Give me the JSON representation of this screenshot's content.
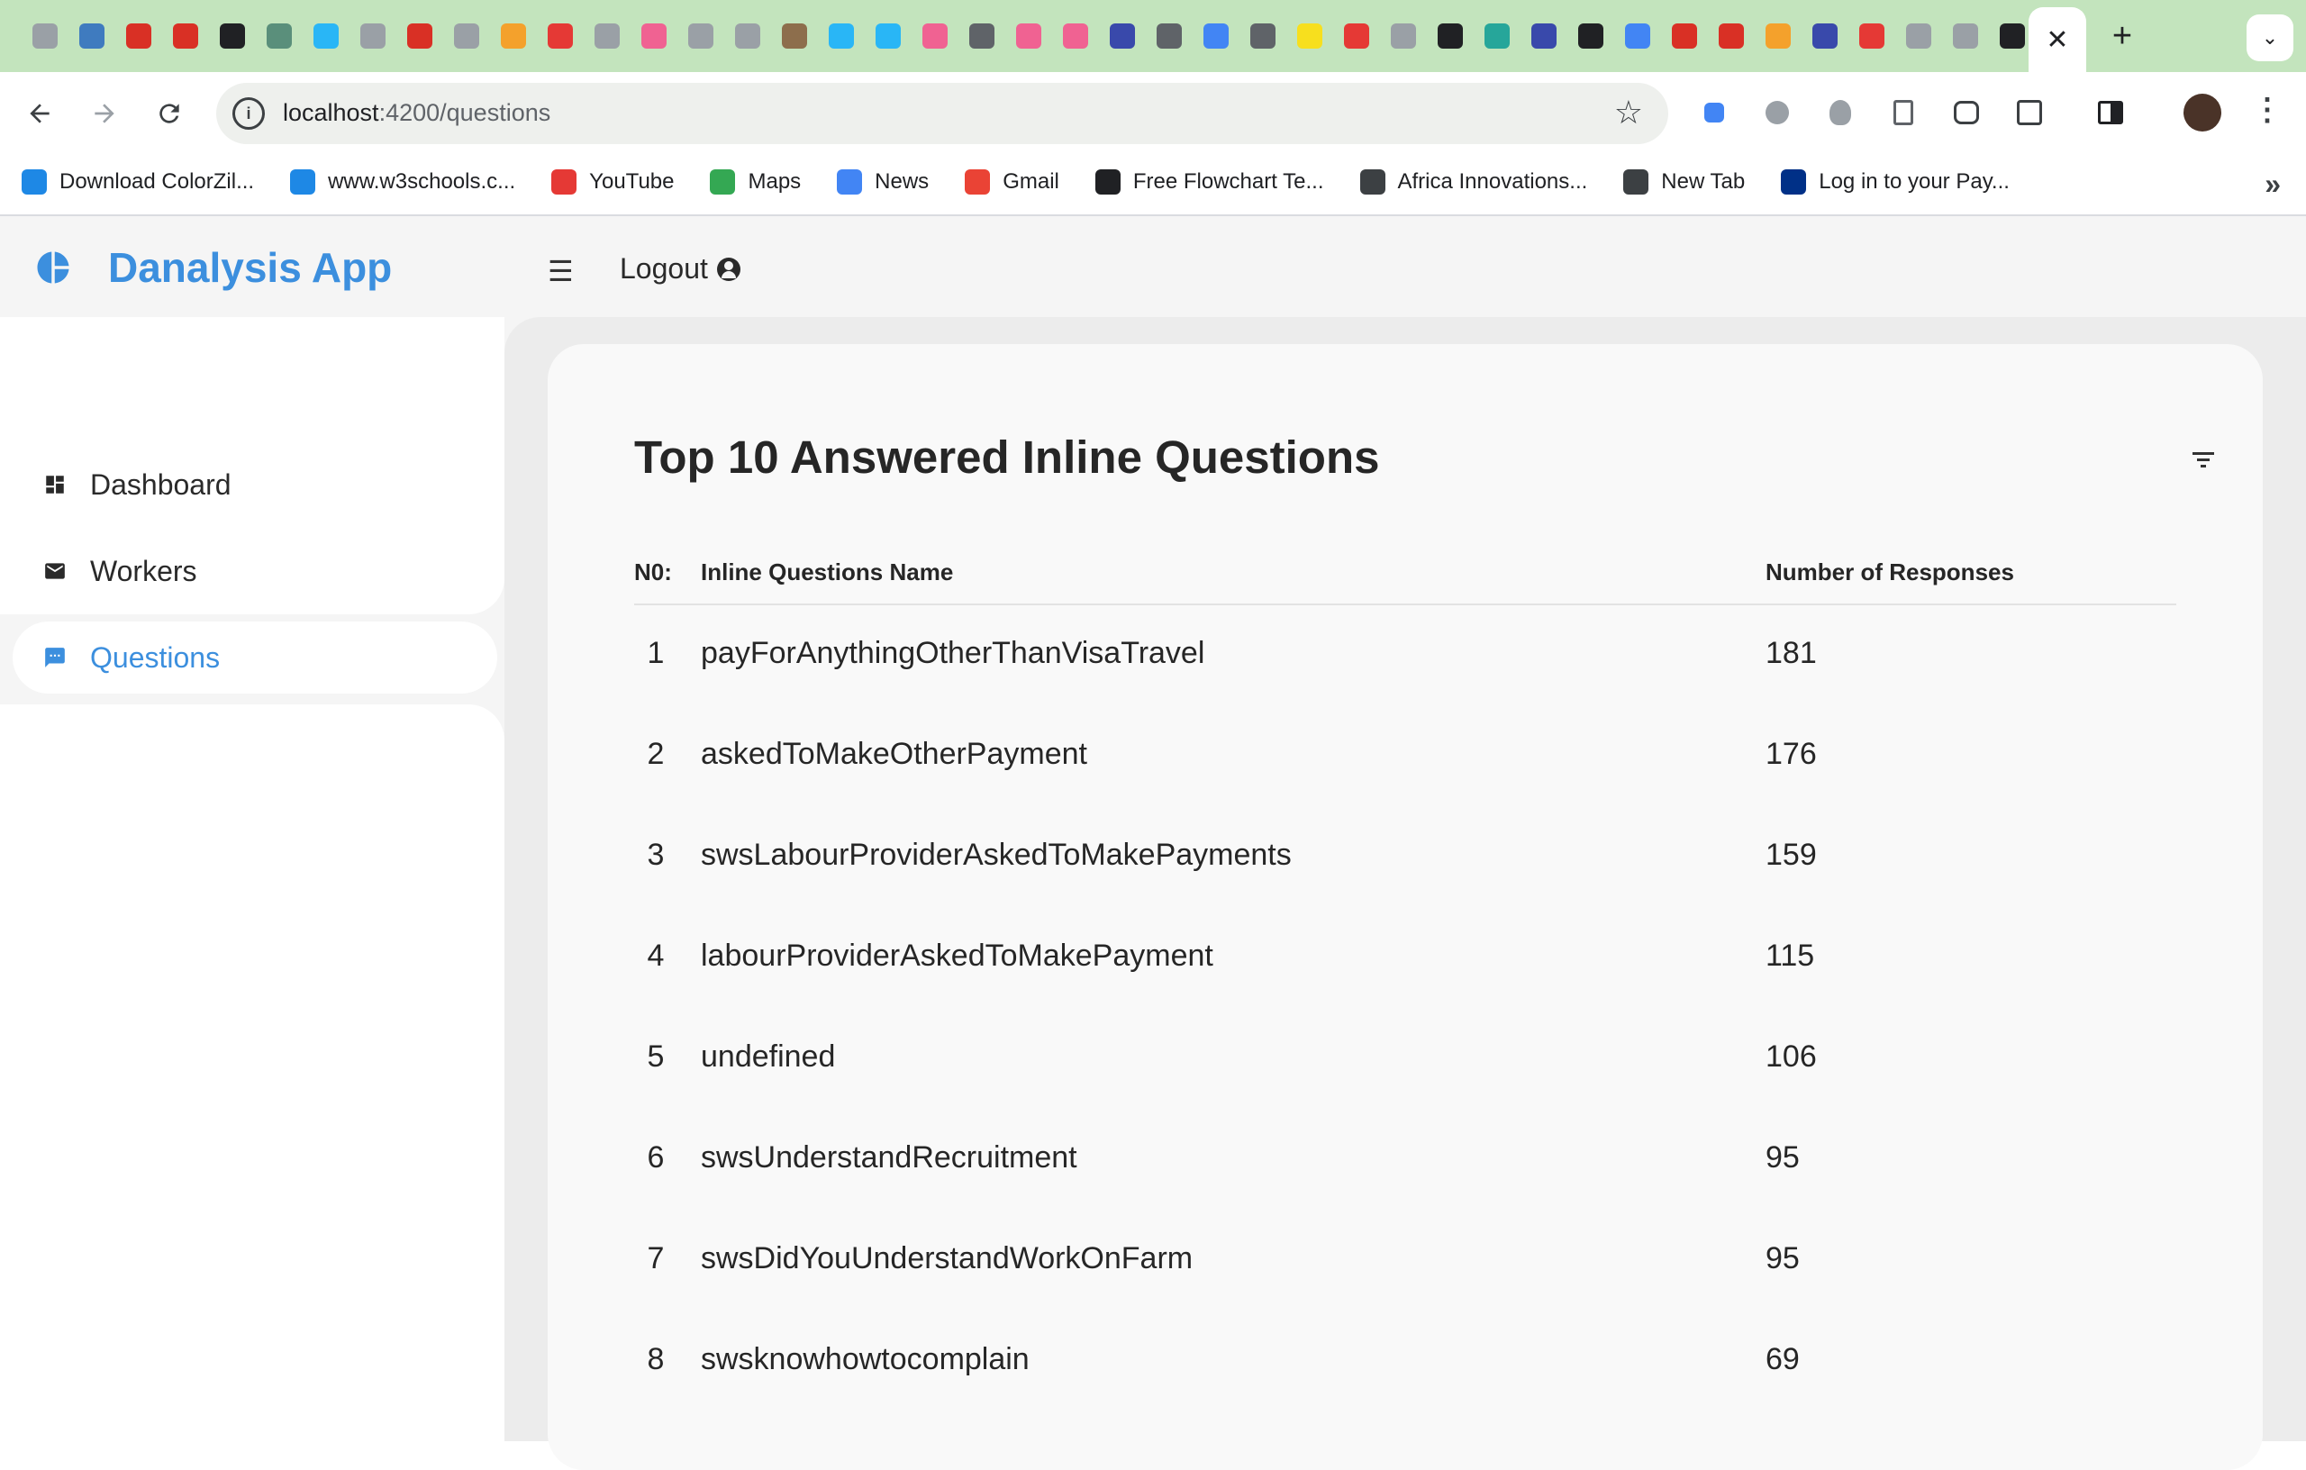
{
  "browser": {
    "active_tab_close": "✕",
    "new_tab": "+",
    "tab_menu": "⌄",
    "url_host": "localhost",
    "url_path": ":4200/questions",
    "tab_icon_colors": [
      "#9aa0a6",
      "#3f7bbf",
      "#d93025",
      "#d93025",
      "#202124",
      "#5a8f7b",
      "#29b6f6",
      "#9aa0a6",
      "#d93025",
      "#9aa0a6",
      "#f4a12c",
      "#e53935",
      "#9aa0a6",
      "#f06292",
      "#9aa0a6",
      "#9aa0a6",
      "#8d6e4c",
      "#29b6f6",
      "#29b6f6",
      "#f06292",
      "#5f6368",
      "#f06292",
      "#f06292",
      "#3949ab",
      "#5f6368",
      "#4285f4",
      "#5f6368",
      "#f7df1e",
      "#e53935",
      "#9aa0a6",
      "#202124",
      "#26a69a",
      "#3949ab",
      "#202124",
      "#4285f4",
      "#d93025",
      "#d93025",
      "#f4a12c",
      "#3949ab",
      "#e53935",
      "#9aa0a6",
      "#9aa0a6",
      "#202124",
      "#8d6e4c"
    ]
  },
  "bookmarks": [
    {
      "label": "Download ColorZil...",
      "color": "#1e88e5"
    },
    {
      "label": "www.w3schools.c...",
      "color": "#1e88e5"
    },
    {
      "label": "YouTube",
      "color": "#e53935"
    },
    {
      "label": "Maps",
      "color": "#34a853"
    },
    {
      "label": "News",
      "color": "#4285f4"
    },
    {
      "label": "Gmail",
      "color": "#ea4335"
    },
    {
      "label": "Free Flowchart Te...",
      "color": "#202124"
    },
    {
      "label": "Africa Innovations...",
      "color": "#3c4043"
    },
    {
      "label": "New Tab",
      "color": "#3c4043"
    },
    {
      "label": "Log in to your Pay...",
      "color": "#003087"
    }
  ],
  "app": {
    "title": "Danalysis App",
    "logout": "Logout",
    "brand_color": "#3c8fde"
  },
  "sidebar": {
    "items": [
      {
        "label": "Dashboard",
        "icon": "dashboard-icon"
      },
      {
        "label": "Workers",
        "icon": "mail-icon"
      },
      {
        "label": "Questions",
        "icon": "chat-icon",
        "active": true
      }
    ]
  },
  "card": {
    "title": "Top 10 Answered Inline Questions",
    "columns": [
      "N0:",
      "Inline Questions Name",
      "Number of Responses"
    ],
    "rows": [
      {
        "no": "1",
        "name": "payForAnythingOtherThanVisaTravel",
        "responses": "181"
      },
      {
        "no": "2",
        "name": "askedToMakeOtherPayment",
        "responses": "176"
      },
      {
        "no": "3",
        "name": "swsLabourProviderAskedToMakePayments",
        "responses": "159"
      },
      {
        "no": "4",
        "name": "labourProviderAskedToMakePayment",
        "responses": "115"
      },
      {
        "no": "5",
        "name": "undefined",
        "responses": "106"
      },
      {
        "no": "6",
        "name": "swsUnderstandRecruitment",
        "responses": "95"
      },
      {
        "no": "7",
        "name": "swsDidYouUnderstandWorkOnFarm",
        "responses": "95"
      },
      {
        "no": "8",
        "name": "swsknowhowtocomplain",
        "responses": "69"
      }
    ]
  }
}
